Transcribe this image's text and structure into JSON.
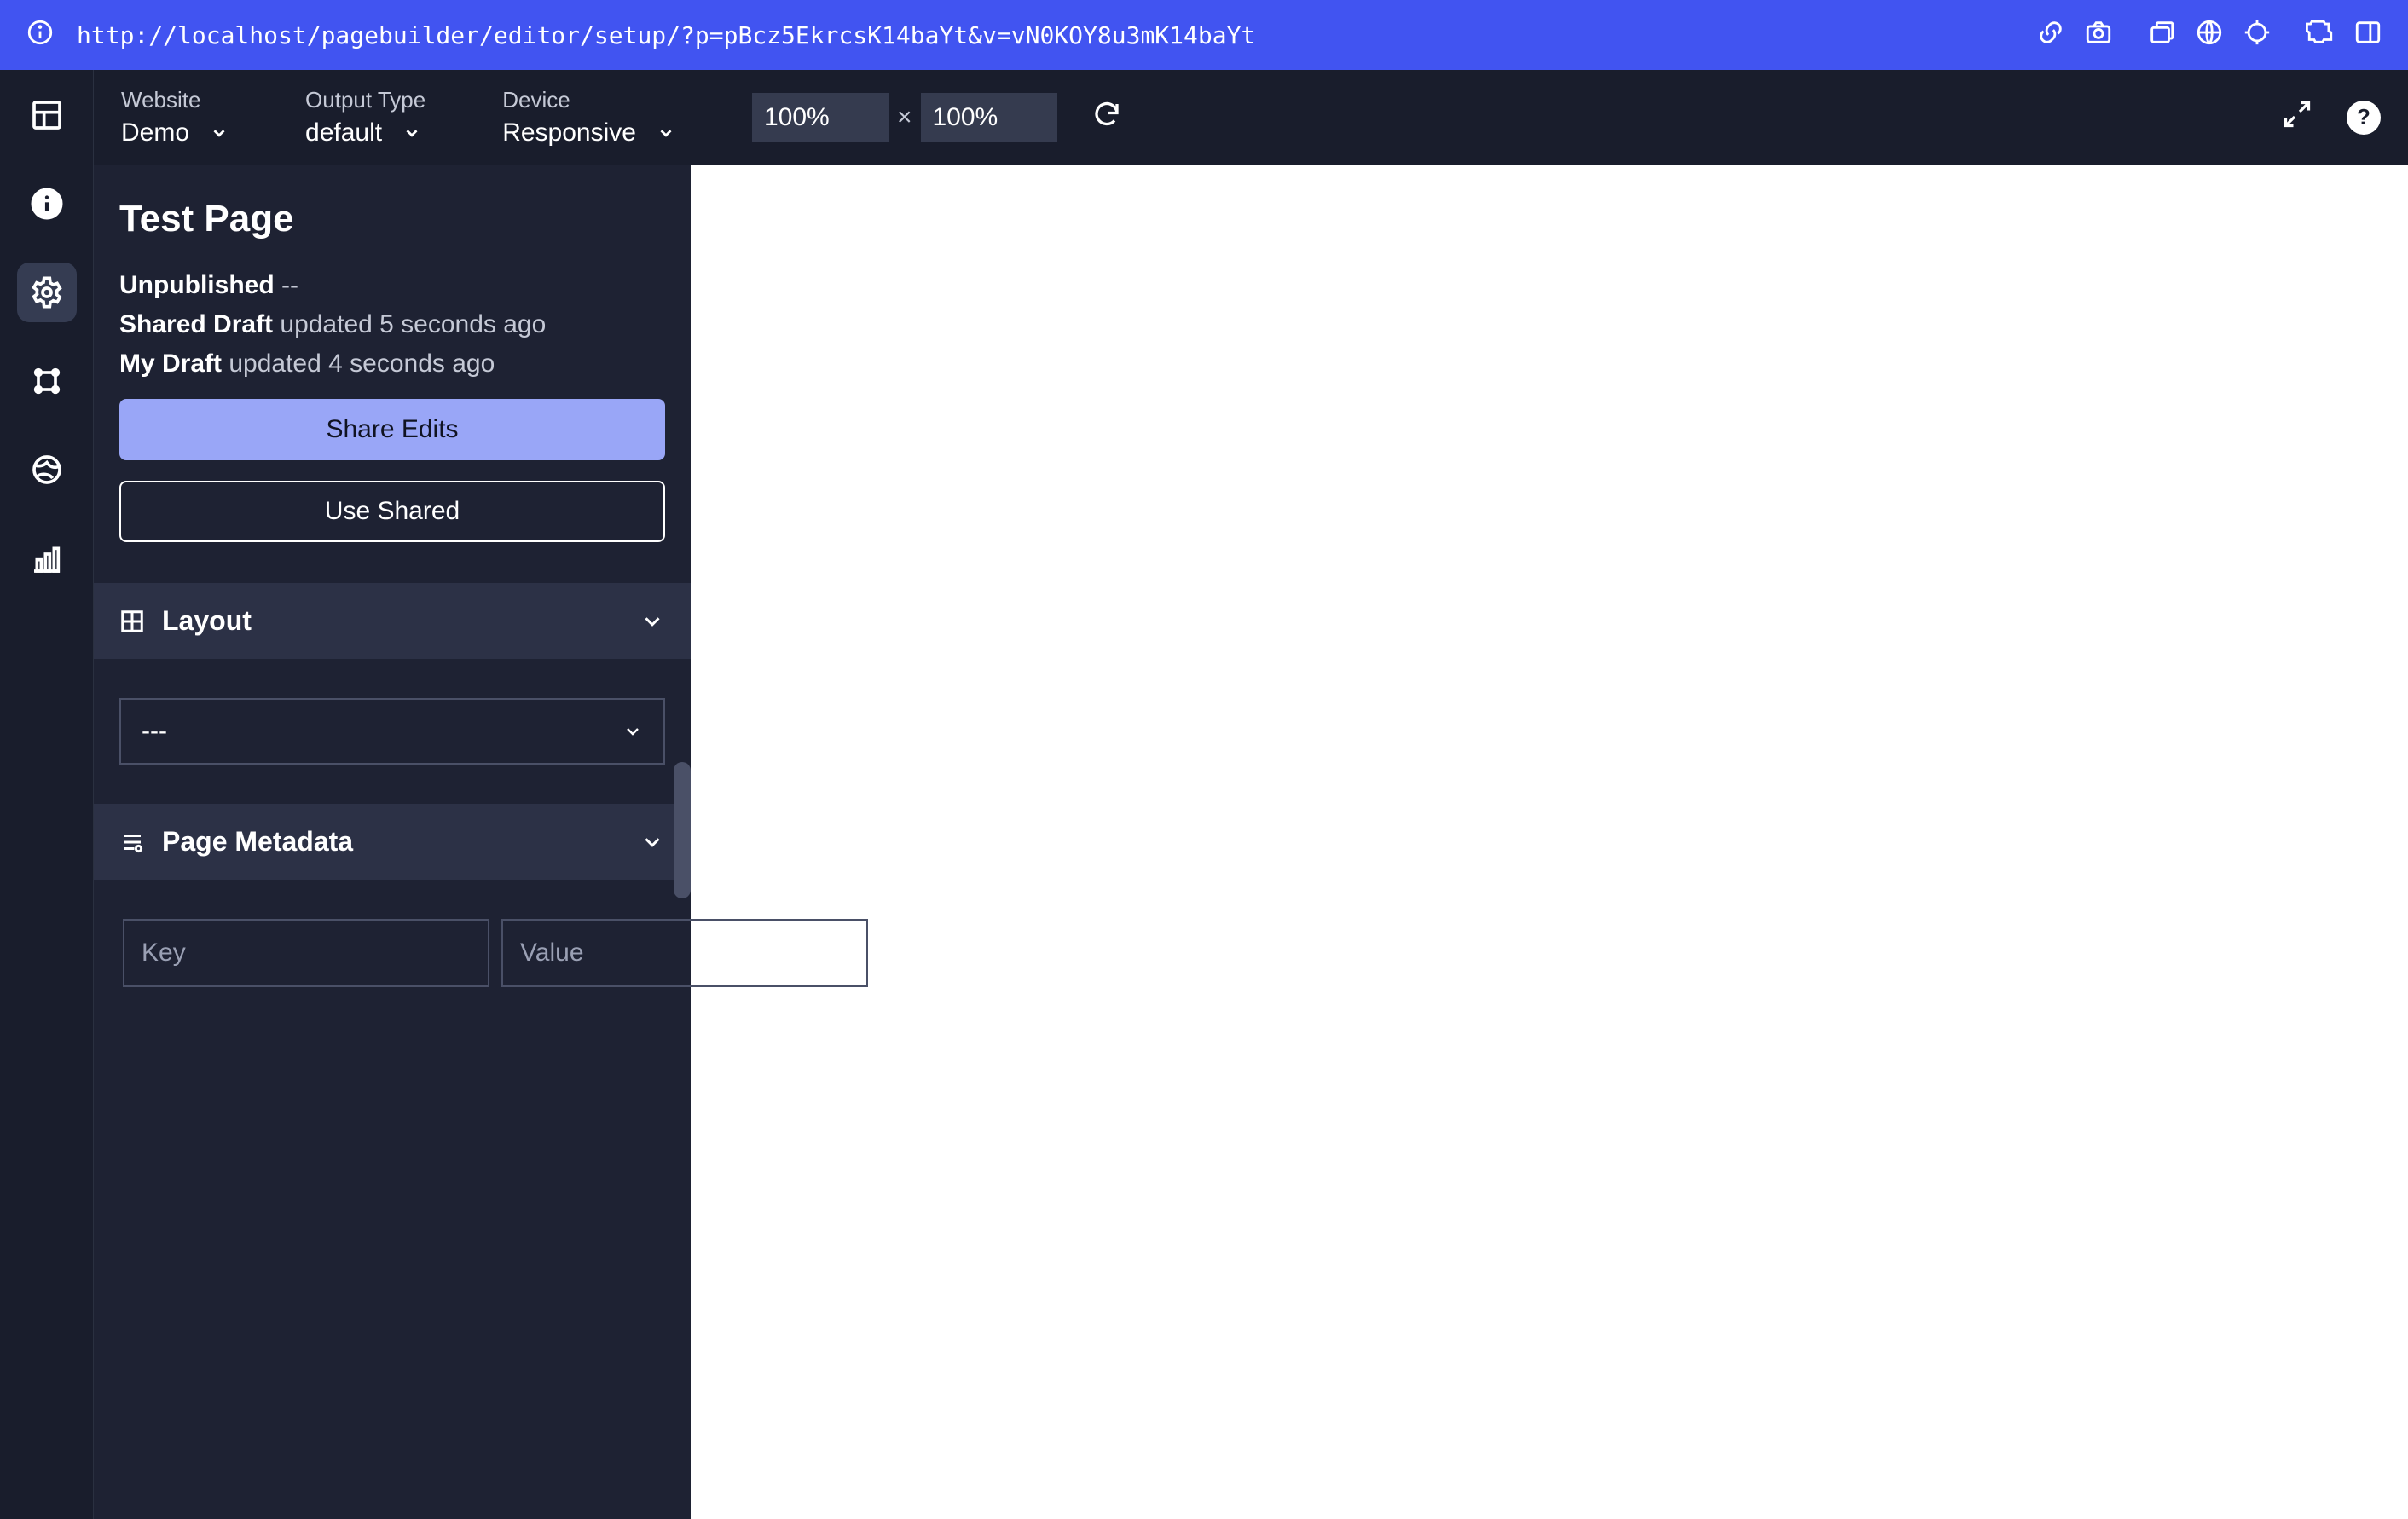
{
  "address_url": "http://localhost/pagebuilder/editor/setup/?p=pBcz5EkrcsK14baYt&v=vN0KOY8u3mK14baYt",
  "toolbar": {
    "website": {
      "label": "Website",
      "value": "Demo"
    },
    "output_type": {
      "label": "Output Type",
      "value": "default"
    },
    "device": {
      "label": "Device",
      "value": "Responsive"
    },
    "zoom_w": "100%",
    "zoom_h": "100%",
    "zoom_separator": "×"
  },
  "sidebar": {
    "page_title": "Test Page",
    "status": {
      "unpublished_label": "Unpublished",
      "unpublished_suffix": " --",
      "shared_draft_label": "Shared Draft",
      "shared_draft_text": " updated 5 seconds ago",
      "my_draft_label": "My Draft",
      "my_draft_text": " updated 4 seconds ago"
    },
    "share_edits_label": "Share Edits",
    "use_shared_label": "Use Shared",
    "layout": {
      "title": "Layout",
      "selected": "---"
    },
    "metadata": {
      "title": "Page Metadata",
      "key_placeholder": "Key",
      "value_placeholder": "Value"
    }
  },
  "help_glyph": "?"
}
